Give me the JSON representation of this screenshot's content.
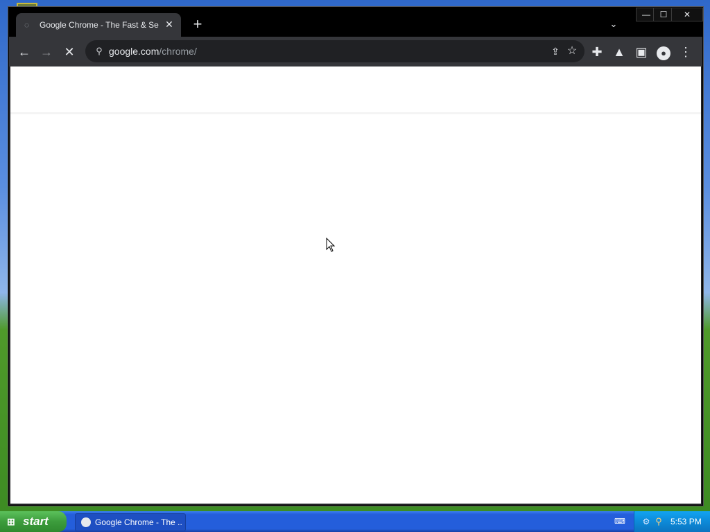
{
  "browser": {
    "tab": {
      "title": "Google Chrome - The Fast & Secure Web Browser Built to be Yours",
      "close_icon": "close-icon",
      "loading_icon": "loading-spinner-icon"
    },
    "new_tab_icon": "plus-icon",
    "tab_search_icon": "chevron-down-icon",
    "window_controls": {
      "minimize": "—",
      "maximize": "☐",
      "close": "✕"
    },
    "toolbar": {
      "back_icon": "←",
      "forward_icon": "→",
      "stop_icon": "✕",
      "url_domain": "google.com",
      "url_path": "/chrome/",
      "site_info_icon": "⚲",
      "share_icon": "⇪",
      "star_icon": "☆",
      "extensions_icon": "✚",
      "labs_icon": "▲",
      "side_panel_icon": "▣",
      "profile_icon": "●",
      "menu_icon": "⋮"
    }
  },
  "taskbar": {
    "start_label": "start",
    "task_label": "Google Chrome - The ...",
    "clock": "5:53 PM"
  },
  "colors": {
    "chrome_dark": "#35363a",
    "titlebar": "#000000",
    "taskbar_blue": "#245edb",
    "start_green": "#3c9c3c"
  }
}
